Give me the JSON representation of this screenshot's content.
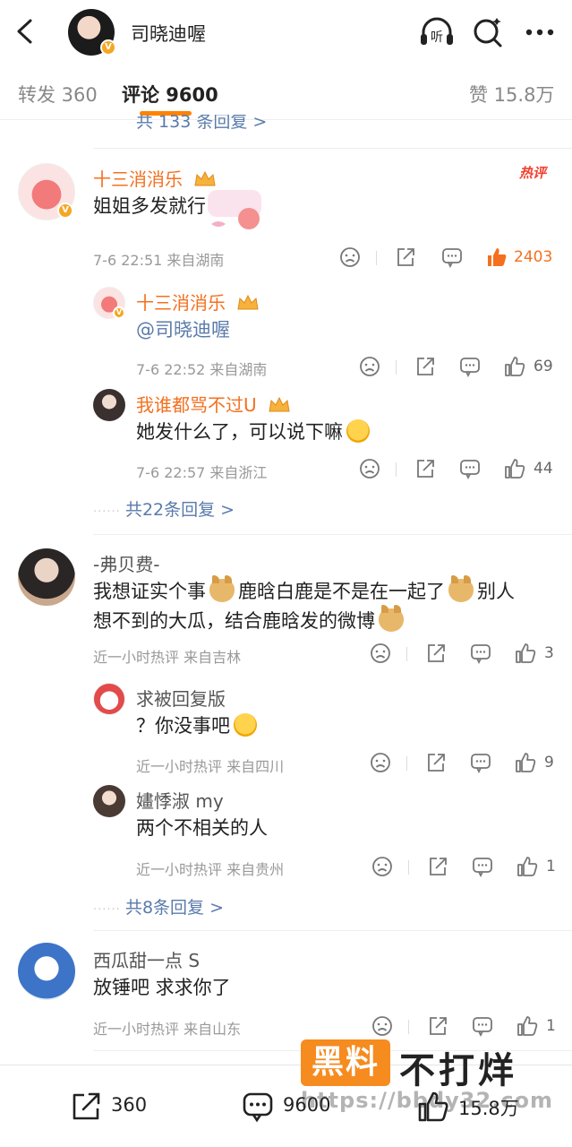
{
  "header": {
    "title": "司晓迪喔",
    "back_icon": "chevron-left-icon",
    "listen_icon": "headphones-listen-icon",
    "listen_label": "听",
    "search_icon": "search-icon",
    "more_icon": "more-dots-icon"
  },
  "tabs": {
    "repost": "转发 360",
    "comments": "评论 9600",
    "likes": "赞 15.8万",
    "accent": "#ff8200"
  },
  "truncated_replies": "共 133 条回复 >",
  "hot_badge": "热评",
  "comments": [
    {
      "name": "十三消消乐",
      "text": "姐姐多发就行",
      "meta": "7-6 22:51 来自湖南",
      "likes": "2403",
      "replies": [
        {
          "name": "十三消消乐",
          "text": "@司晓迪喔",
          "meta": "7-6 22:52 来自湖南",
          "likes": "69"
        },
        {
          "name": "我谁都骂不过U",
          "text": "她发什么了，可以说下嘛",
          "meta": "7-6 22:57 来自浙江",
          "likes": "44"
        }
      ],
      "more": "共22条回复 >"
    },
    {
      "name": "-弗贝费-",
      "text_parts": [
        "我想证实个事",
        "鹿晗白鹿是不是在一起了",
        "别人",
        "想不到的大瓜，结合鹿晗发的微博"
      ],
      "meta": "近一小时热评 来自吉林",
      "likes": "3",
      "replies": [
        {
          "name": "求被回复版",
          "text": "？你没事吧",
          "meta": "近一小时热评 来自四川",
          "likes": "9"
        },
        {
          "name": "嫿悸淑 my",
          "text": "两个不相关的人",
          "meta": "近一小时热评 来自贵州",
          "likes": "1"
        }
      ],
      "more": "共8条回复 >"
    },
    {
      "name": "西瓜甜一点 S",
      "text": "放锤吧 求求你了",
      "meta": "近一小时热评 来自山东",
      "likes": "1"
    }
  ],
  "bottom": {
    "repost_count": "360",
    "comment_count": "9600",
    "like_count": "15.8万"
  },
  "watermark": {
    "box": "黑料",
    "text": "不打烊",
    "url": "https://bbdy32.com"
  }
}
